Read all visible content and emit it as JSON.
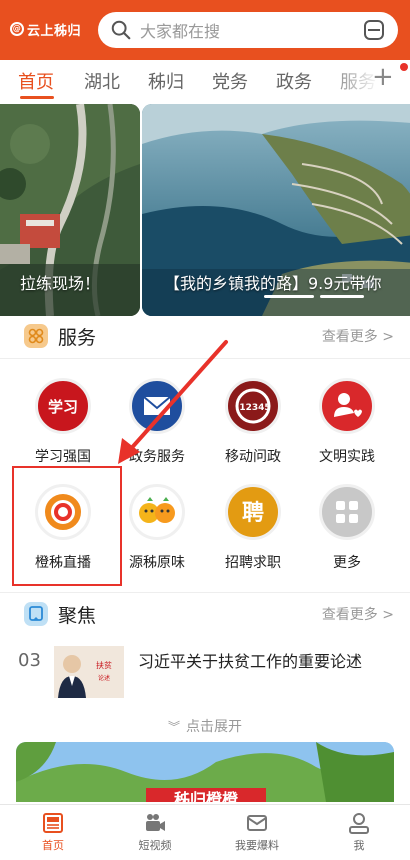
{
  "header": {
    "logo_text": "云上秭归",
    "search_placeholder": "大家都在搜"
  },
  "tabs": [
    {
      "label": "首页",
      "active": true
    },
    {
      "label": "湖北"
    },
    {
      "label": "秭归"
    },
    {
      "label": "党务"
    },
    {
      "label": "政务"
    },
    {
      "label": "服务"
    }
  ],
  "banners": [
    {
      "caption": "拉练现场！"
    },
    {
      "caption": "【我的乡镇我的路】9.9元带你"
    }
  ],
  "services_section": {
    "title": "服务",
    "more": "查看更多 >"
  },
  "services": [
    {
      "label": "学习强国",
      "icon": "xuexi-qiangguo-icon",
      "color": "#c8161d",
      "glyph": "学习"
    },
    {
      "label": "政务服务",
      "icon": "envelope-icon",
      "color": "#1f4e9e"
    },
    {
      "label": "移动问政",
      "icon": "hotline-12345-icon",
      "color": "#8b1a1a",
      "glyph": "12345"
    },
    {
      "label": "文明实践",
      "icon": "person-heart-icon",
      "color": "#d9282b"
    },
    {
      "label": "橙秭直播",
      "icon": "orange-swirl-icon",
      "color": "#f08a1c"
    },
    {
      "label": "源秭原味",
      "icon": "orange-mascots-icon",
      "color": "#f4b41a"
    },
    {
      "label": "招聘求职",
      "icon": "hire-icon",
      "color": "#e39b12",
      "glyph": "聘"
    },
    {
      "label": "更多",
      "icon": "grid-more-icon",
      "color": "#c8c8c8"
    }
  ],
  "focus_section": {
    "title": "聚焦",
    "more": "查看更多 >"
  },
  "news": [
    {
      "num": "03",
      "headline": "习近平关于扶贫工作的重要论述"
    }
  ],
  "expand_label": "点击展开",
  "bottom_banner_text": "秭归橙橙",
  "bottom_nav": [
    {
      "label": "首页",
      "icon": "home-news-icon",
      "active": true
    },
    {
      "label": "短视频",
      "icon": "video-camera-icon"
    },
    {
      "label": "我要爆料",
      "icon": "mail-icon"
    },
    {
      "label": "我",
      "icon": "person-icon"
    }
  ]
}
